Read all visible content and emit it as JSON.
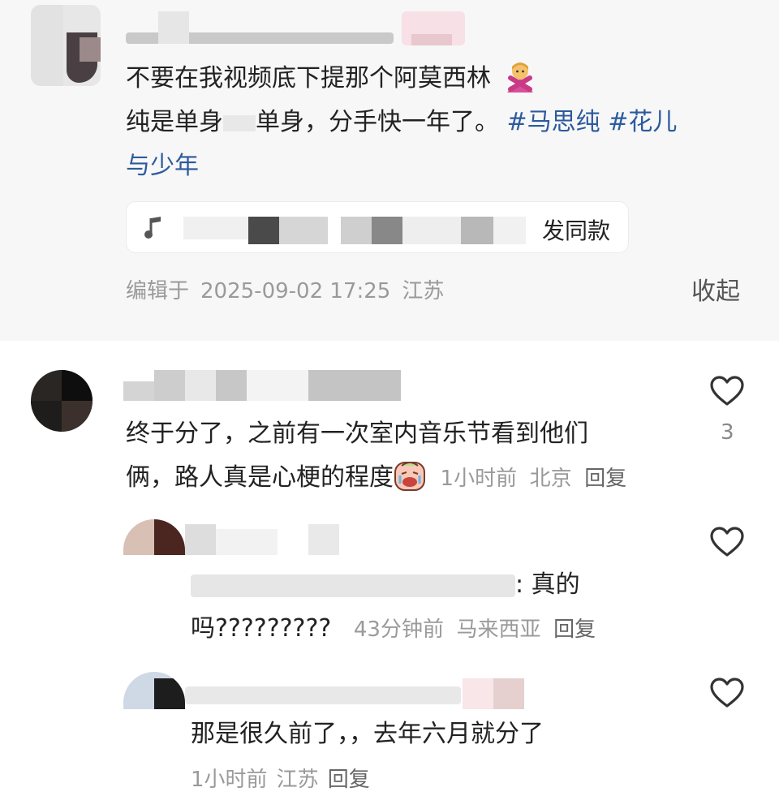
{
  "post": {
    "text_line1": "不要在我视频底下提那个阿莫西林",
    "text_line2_a": "纯是单身",
    "text_line2_b": "单身，分手快一年了。",
    "hashtag1": "#马思纯",
    "hashtag2_part1": "#花儿",
    "hashtag2_part2": "与少年",
    "emoji": "🙅‍♀️",
    "music_chip_label": "发同款",
    "meta_prefix": "编辑于",
    "meta_datetime": "2025-09-02 17:25",
    "meta_location": "江苏",
    "collapse_label": "收起"
  },
  "comments": [
    {
      "text_line1": "终于分了，之前有一次室内音乐节看到他们",
      "text_line2": "俩，路人真是心梗的程度",
      "time": "1小时前",
      "location": "北京",
      "reply_label": "回复",
      "like_count": "3"
    },
    {
      "reply_to_suffix": ": 真的",
      "text_line2": "吗?????????",
      "time": "43分钟前",
      "location": "马来西亚",
      "reply_label": "回复"
    },
    {
      "text_line1": "那是很久前了，，去年六月就分了",
      "time": "1小时前",
      "location": "江苏",
      "reply_label": "回复"
    }
  ],
  "icons": {
    "heart": "heart-outline-icon",
    "music": "music-note-icon",
    "emoji_crying": "crying-emoji-icon",
    "emoji_gesture": "no-gesture-emoji-icon"
  },
  "colors": {
    "hashtag": "#2c5a9e",
    "meta": "#9a9a9a",
    "post_background": "#f7f7f7"
  }
}
